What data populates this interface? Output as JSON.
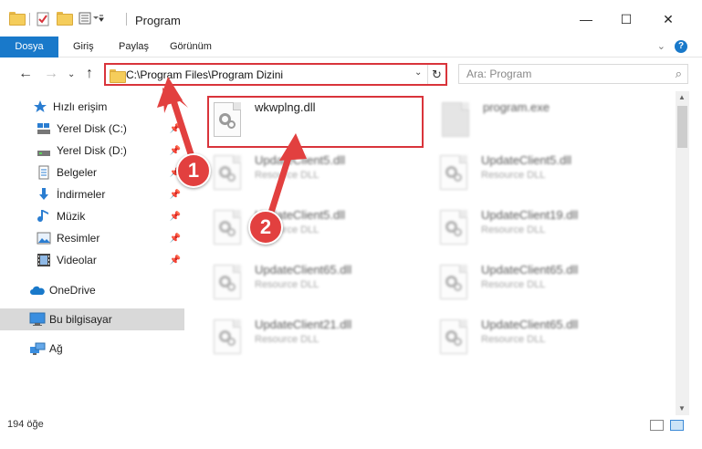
{
  "window": {
    "title": "Program",
    "minimize": "—",
    "maximize": "☐",
    "close": "✕"
  },
  "ribbon": {
    "tabs": [
      {
        "label": "Dosya",
        "active": true
      },
      {
        "label": "Giriş"
      },
      {
        "label": "Paylaş"
      },
      {
        "label": "Görünüm"
      }
    ],
    "help": "?"
  },
  "address": {
    "path": "C:\\Program Files\\Program Dizini",
    "search_placeholder": "Ara: Program"
  },
  "sidebar": {
    "items": [
      {
        "label": "Hızlı erişim",
        "icon": "star-icon",
        "pinned": false
      },
      {
        "label": "Yerel Disk (C:)",
        "icon": "drive-icon",
        "pinned": true
      },
      {
        "label": "Yerel Disk (D:)",
        "icon": "drive-icon",
        "pinned": true
      },
      {
        "label": "Belgeler",
        "icon": "documents-icon",
        "pinned": true
      },
      {
        "label": "İndirmeler",
        "icon": "download-icon",
        "pinned": true
      },
      {
        "label": "Müzik",
        "icon": "music-icon",
        "pinned": true
      },
      {
        "label": "Resimler",
        "icon": "pictures-icon",
        "pinned": true
      },
      {
        "label": "Videolar",
        "icon": "video-icon",
        "pinned": true
      },
      {
        "label": "OneDrive",
        "icon": "cloud-icon",
        "pinned": false
      },
      {
        "label": "Bu bilgisayar",
        "icon": "computer-icon",
        "pinned": false,
        "selected": true
      },
      {
        "label": "Ağ",
        "icon": "network-icon",
        "pinned": false
      }
    ]
  },
  "files": [
    {
      "name": "wkwplng.dll",
      "desc": "",
      "highlighted": true
    },
    {
      "name": "program.exe",
      "desc": ""
    },
    {
      "name": "UpdateClient5.dll",
      "desc": "Resource DLL"
    },
    {
      "name": "UpdateClient5.dll",
      "desc": "Resource DLL"
    },
    {
      "name": "UpdateClient5.dll",
      "desc": "Resource DLL"
    },
    {
      "name": "UpdateClient19.dll",
      "desc": "Resource DLL"
    },
    {
      "name": "UpdateClient65.dll",
      "desc": "Resource DLL"
    },
    {
      "name": "UpdateClient65.dll",
      "desc": "Resource DLL"
    },
    {
      "name": "UpdateClient21.dll",
      "desc": "Resource DLL"
    },
    {
      "name": "UpdateClient65.dll",
      "desc": "Resource DLL"
    }
  ],
  "status": {
    "count": "194 öğe"
  },
  "annotations": {
    "step1": "1",
    "step2": "2",
    "color": "#e2403f"
  }
}
